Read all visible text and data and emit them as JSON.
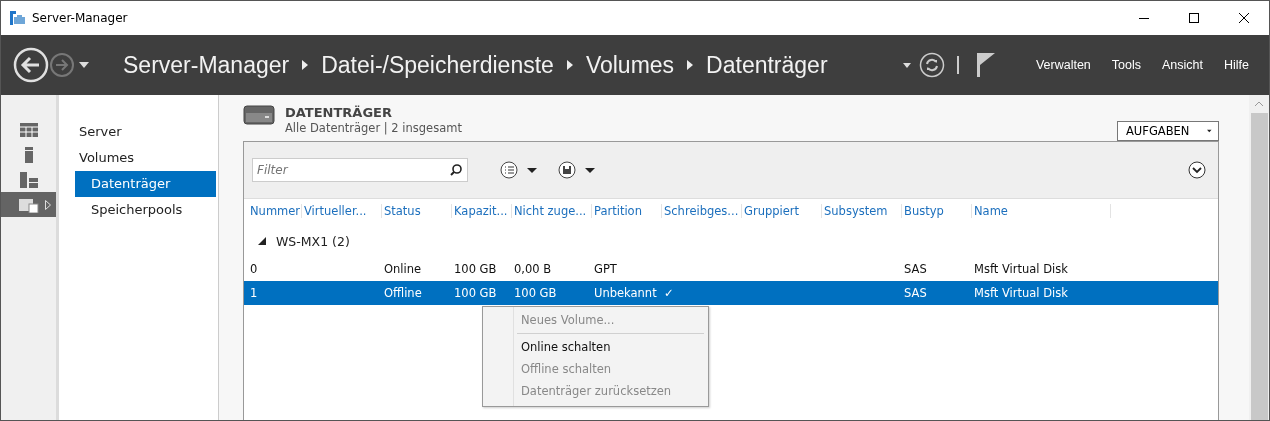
{
  "window": {
    "title": "Server-Manager"
  },
  "header": {
    "breadcrumb": [
      "Server-Manager",
      "Datei-/Speicherdienste",
      "Volumes",
      "Datenträger"
    ],
    "menu": [
      "Verwalten",
      "Tools",
      "Ansicht",
      "Hilfe"
    ]
  },
  "icon_strip": [
    {
      "kind": "dashboard",
      "selected": false
    },
    {
      "kind": "server",
      "selected": false
    },
    {
      "kind": "servers",
      "selected": false
    },
    {
      "kind": "files",
      "selected": true
    }
  ],
  "sidebar": {
    "items": [
      {
        "label": "Server",
        "selected": false
      },
      {
        "label": "Volumes",
        "selected": false,
        "children": [
          {
            "label": "Datenträger",
            "selected": true
          },
          {
            "label": "Speicherpools",
            "selected": false
          }
        ]
      }
    ]
  },
  "panel": {
    "title": "DATENTRÄGER",
    "subtitle": "Alle Datenträger | 2 insgesamt",
    "tasks_button": "AUFGABEN",
    "filter": {
      "placeholder": "Filter"
    }
  },
  "table": {
    "columns": [
      "Nummer",
      "Virtueller...",
      "Status",
      "Kapazit...",
      "Nicht zuge...",
      "Partition",
      "Schreibges...",
      "Gruppiert",
      "Subsystem",
      "Bustyp",
      "Name"
    ],
    "group": {
      "label": "WS-MX1 (2)",
      "expanded": true
    },
    "rows": [
      {
        "cells": [
          "0",
          "",
          "Online",
          "100 GB",
          "0,00 B",
          "GPT",
          "",
          "",
          "",
          "SAS",
          "Msft Virtual Disk"
        ],
        "selected": false
      },
      {
        "cells": [
          "1",
          "",
          "Offline",
          "100 GB",
          "100 GB",
          "Unbekannt",
          "✓",
          "",
          "",
          "SAS",
          "Msft Virtual Disk"
        ],
        "selected": true
      }
    ]
  },
  "context_menu": [
    {
      "label": "Neues Volume...",
      "disabled": true,
      "separator_after": true
    },
    {
      "label": "Online schalten",
      "disabled": false,
      "separator_after": false
    },
    {
      "label": "Offline schalten",
      "disabled": true,
      "separator_after": false
    },
    {
      "label": "Datenträger zurücksetzen",
      "disabled": true,
      "separator_after": false
    }
  ]
}
